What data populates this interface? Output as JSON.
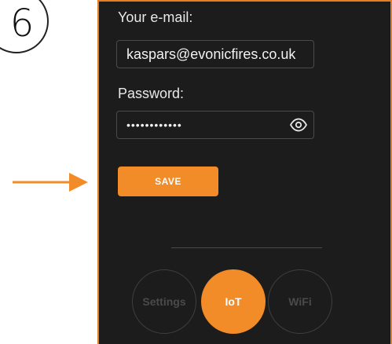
{
  "step": {
    "number": "6"
  },
  "form": {
    "email_label": "Your e-mail:",
    "email_value": "kaspars@evonicfires.co.uk",
    "password_label": "Password:",
    "password_value": "••••••••••••",
    "save_label": "SAVE"
  },
  "nav": {
    "items": [
      {
        "label": "Settings",
        "active": false
      },
      {
        "label": "IoT",
        "active": true
      },
      {
        "label": "WiFi",
        "active": false
      }
    ]
  },
  "icons": {
    "pointer": "arrow-right-icon",
    "password_toggle": "eye-icon"
  },
  "colors": {
    "accent": "#f28c28",
    "screen_background": "#1c1c1c",
    "frame": "#e87c22"
  }
}
